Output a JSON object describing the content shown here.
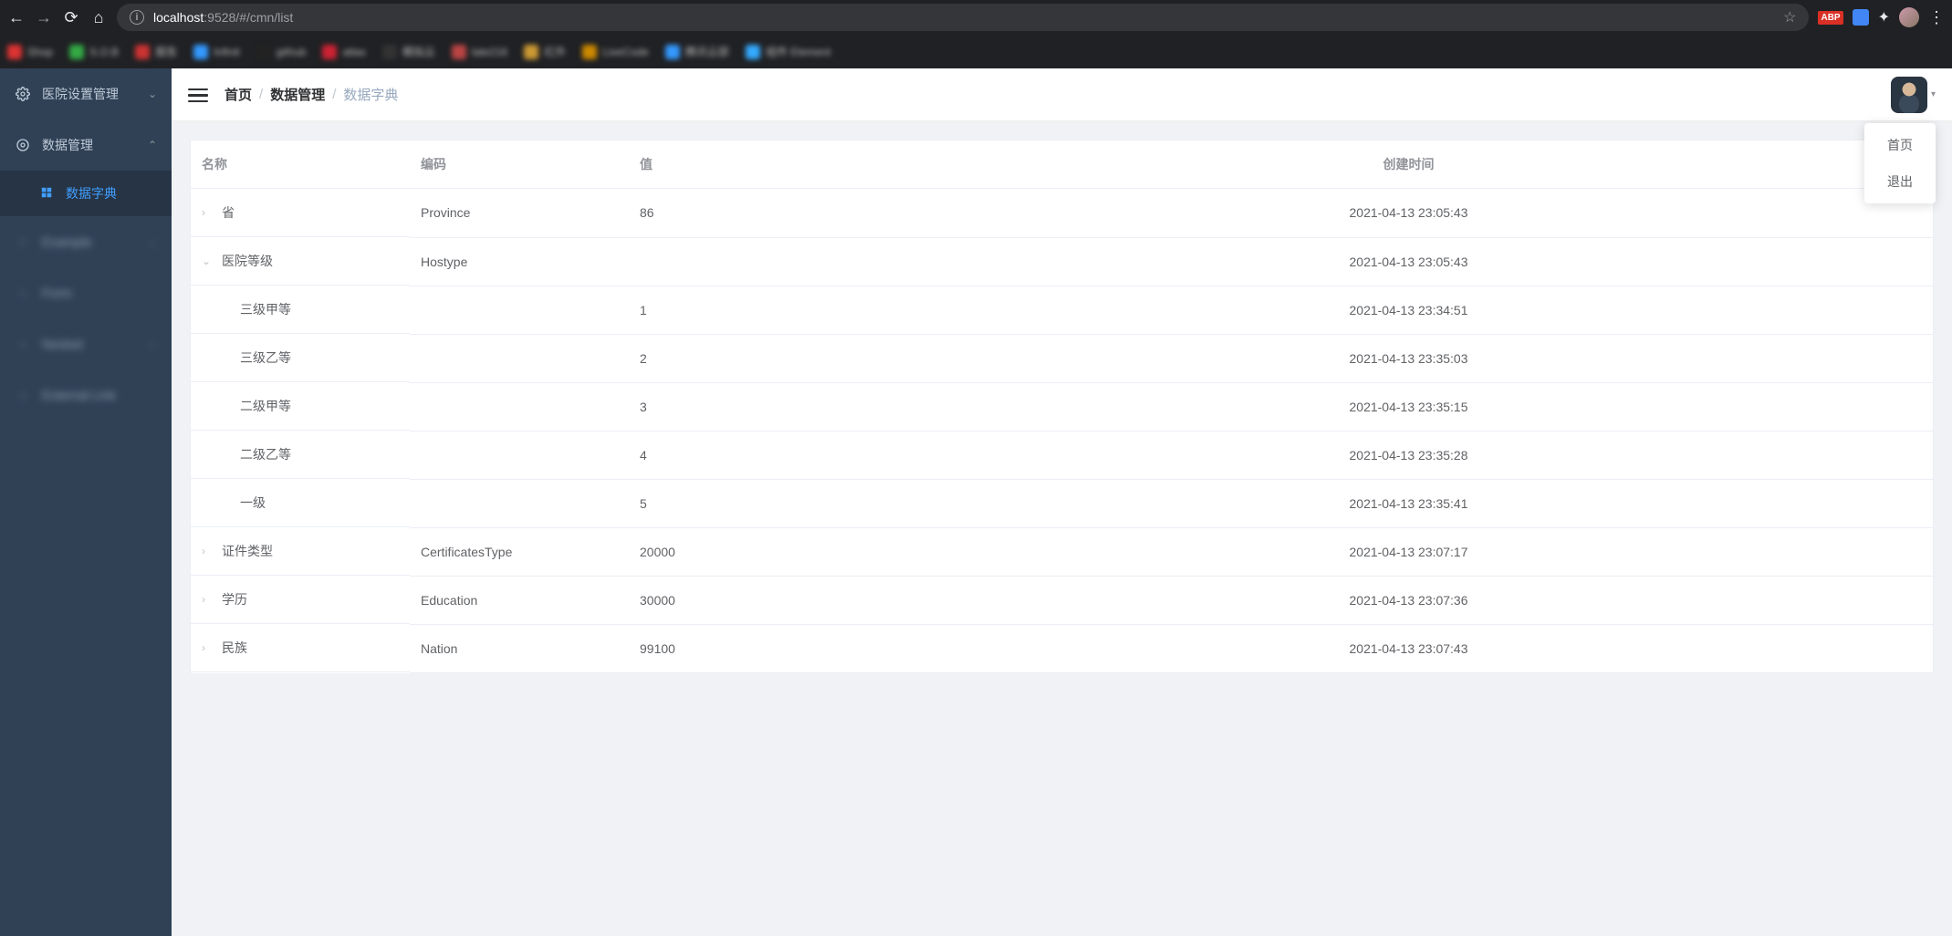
{
  "browser": {
    "url_host": "localhost",
    "url_rest": ":9528/#/cmn/list",
    "ext_badge": "ABP"
  },
  "sidebar": {
    "items": [
      {
        "label": "医院设置管理",
        "expanded": false
      },
      {
        "label": "数据管理",
        "expanded": true,
        "children": [
          {
            "label": "数据字典",
            "active": true
          }
        ]
      },
      {
        "label": "Example",
        "blur": true
      },
      {
        "label": "Form",
        "blur": true
      },
      {
        "label": "Nested",
        "blur": true
      },
      {
        "label": "External Link",
        "blur": true
      }
    ]
  },
  "breadcrumb": {
    "items": [
      "首页",
      "数据管理",
      "数据字典"
    ]
  },
  "dropdown": {
    "items": [
      "首页",
      "退出"
    ]
  },
  "table": {
    "headers": {
      "name": "名称",
      "code": "编码",
      "value": "值",
      "created": "创建时间"
    },
    "rows": [
      {
        "indent": 0,
        "expand": "closed",
        "name": "省",
        "code": "Province",
        "value": "86",
        "created": "2021-04-13 23:05:43"
      },
      {
        "indent": 0,
        "expand": "open",
        "name": "医院等级",
        "code": "Hostype",
        "value": "",
        "created": "2021-04-13 23:05:43"
      },
      {
        "indent": 1,
        "expand": "none",
        "name": "三级甲等",
        "code": "",
        "value": "1",
        "created": "2021-04-13 23:34:51"
      },
      {
        "indent": 1,
        "expand": "none",
        "name": "三级乙等",
        "code": "",
        "value": "2",
        "created": "2021-04-13 23:35:03"
      },
      {
        "indent": 1,
        "expand": "none",
        "name": "二级甲等",
        "code": "",
        "value": "3",
        "created": "2021-04-13 23:35:15"
      },
      {
        "indent": 1,
        "expand": "none",
        "name": "二级乙等",
        "code": "",
        "value": "4",
        "created": "2021-04-13 23:35:28"
      },
      {
        "indent": 1,
        "expand": "none",
        "name": "一级",
        "code": "",
        "value": "5",
        "created": "2021-04-13 23:35:41"
      },
      {
        "indent": 0,
        "expand": "closed",
        "name": "证件类型",
        "code": "CertificatesType",
        "value": "20000",
        "created": "2021-04-13 23:07:17"
      },
      {
        "indent": 0,
        "expand": "closed",
        "name": "学历",
        "code": "Education",
        "value": "30000",
        "created": "2021-04-13 23:07:36"
      },
      {
        "indent": 0,
        "expand": "closed",
        "name": "民族",
        "code": "Nation",
        "value": "99100",
        "created": "2021-04-13 23:07:43"
      }
    ]
  }
}
